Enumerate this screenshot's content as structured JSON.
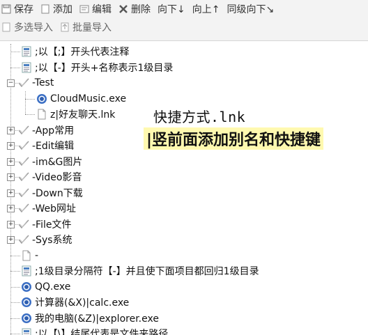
{
  "toolbar_row1": [
    {
      "label": "保存",
      "icon": "save-icon"
    },
    {
      "label": "添加",
      "icon": "add-icon"
    },
    {
      "label": "编辑",
      "icon": "edit-icon"
    },
    {
      "label": "删除",
      "icon": "delete-icon"
    },
    {
      "label": "向下↓",
      "icon": ""
    },
    {
      "label": "向上↑",
      "icon": ""
    },
    {
      "label": "同级向下↘",
      "icon": ""
    }
  ],
  "toolbar_row2": [
    {
      "label": "多选导入",
      "icon": "multi-import-icon"
    },
    {
      "label": "批量导入",
      "icon": "batch-import-icon"
    }
  ],
  "tree": [
    {
      "label": ";以【;】开头代表注释",
      "icon": "note-icon",
      "level": 1,
      "expander": ""
    },
    {
      "label": ";以【-】开头+名称表示1级目录",
      "icon": "note-icon",
      "level": 1,
      "expander": ""
    },
    {
      "label": "-Test",
      "icon": "folder-check-icon",
      "level": 0,
      "expander": "−"
    },
    {
      "label": "CloudMusic.exe",
      "icon": "app-icon",
      "level": 2,
      "expander": ""
    },
    {
      "label": "z|好友聊天.lnk",
      "icon": "file-icon",
      "level": 2,
      "expander": ""
    },
    {
      "label": "-App常用",
      "icon": "folder-check-icon",
      "level": 0,
      "expander": "+"
    },
    {
      "label": "-Edit编辑",
      "icon": "folder-check-icon",
      "level": 0,
      "expander": "+"
    },
    {
      "label": "-im&G图片",
      "icon": "folder-check-icon",
      "level": 0,
      "expander": "+"
    },
    {
      "label": "-Video影音",
      "icon": "folder-check-icon",
      "level": 0,
      "expander": "+"
    },
    {
      "label": "-Down下载",
      "icon": "folder-check-icon",
      "level": 0,
      "expander": "+"
    },
    {
      "label": "-Web网址",
      "icon": "folder-check-icon",
      "level": 0,
      "expander": "+"
    },
    {
      "label": "-File文件",
      "icon": "folder-check-icon",
      "level": 0,
      "expander": "+"
    },
    {
      "label": "-Sys系统",
      "icon": "folder-check-icon",
      "level": 0,
      "expander": "+"
    },
    {
      "label": "-",
      "icon": "file-icon",
      "level": 1,
      "expander": ""
    },
    {
      "label": ";1级目录分隔符【-】并且使下面项目都回归1级目录",
      "icon": "note-icon",
      "level": 1,
      "expander": ""
    },
    {
      "label": "QQ.exe",
      "icon": "app-icon",
      "level": 1,
      "expander": ""
    },
    {
      "label": "计算器(&X)|calc.exe",
      "icon": "app-icon",
      "level": 1,
      "expander": ""
    },
    {
      "label": "我的电脑(&Z)|explorer.exe",
      "icon": "app-icon",
      "level": 1,
      "expander": ""
    },
    {
      "label": ";以【\\】结尾代表是文件夹路径",
      "icon": "note-icon",
      "level": 1,
      "expander": ""
    }
  ],
  "overlay": {
    "line1": "快捷方式.lnk",
    "line2": "|竖前面添加别名和快捷键"
  }
}
